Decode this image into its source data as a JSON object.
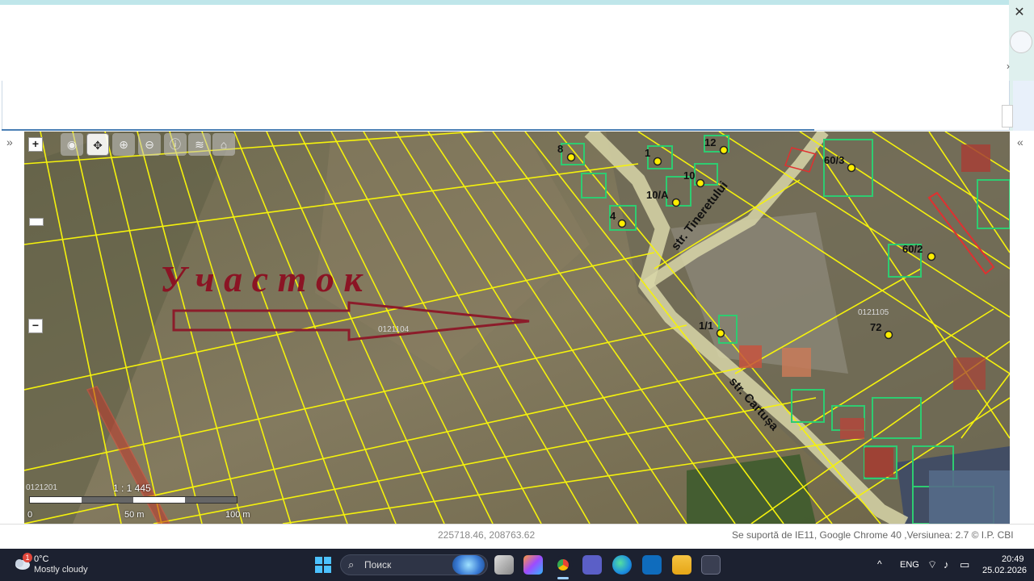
{
  "map": {
    "label_uchastok": "У ч а с т о к",
    "street_tineretului": "str. Tineretului",
    "street_cartusa": "str. Cartușa",
    "sector_labels": [
      "0121104",
      "0121105",
      "0121201"
    ],
    "house_numbers": [
      "8",
      "1",
      "12",
      "10",
      "10/A",
      "4",
      "60/3",
      "60/2",
      "1/1",
      "72"
    ],
    "scale_ratio": "1 : 1 445",
    "scale_ticks": [
      "0",
      "50 m",
      "100 m"
    ],
    "zoom_in": "+",
    "zoom_out": "−"
  },
  "footer": {
    "coordinates": "225718.46, 208763.62",
    "support_text": "Se suportă de IE11, Google Chrome 40 ,Versiunea: 2.7 © I.P. CBI"
  },
  "taskbar": {
    "weather_badge": "1",
    "weather_temp": "0°C",
    "weather_desc": "Mostly cloudy",
    "search_placeholder": "Поиск",
    "language": "ENG",
    "time": "20:49",
    "date": "25.02.2026"
  },
  "icons": {
    "close": "✕",
    "chevron_right": "›",
    "collapse_left": "»",
    "collapse_right": "«"
  }
}
